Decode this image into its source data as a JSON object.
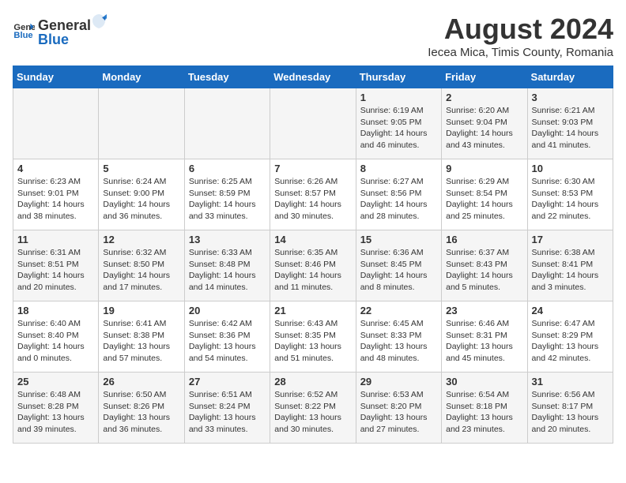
{
  "logo": {
    "general": "General",
    "blue": "Blue"
  },
  "title": "August 2024",
  "subtitle": "Iecea Mica, Timis County, Romania",
  "days_of_week": [
    "Sunday",
    "Monday",
    "Tuesday",
    "Wednesday",
    "Thursday",
    "Friday",
    "Saturday"
  ],
  "weeks": [
    [
      {
        "day": "",
        "content": ""
      },
      {
        "day": "",
        "content": ""
      },
      {
        "day": "",
        "content": ""
      },
      {
        "day": "",
        "content": ""
      },
      {
        "day": "1",
        "content": "Sunrise: 6:19 AM\nSunset: 9:05 PM\nDaylight: 14 hours and 46 minutes."
      },
      {
        "day": "2",
        "content": "Sunrise: 6:20 AM\nSunset: 9:04 PM\nDaylight: 14 hours and 43 minutes."
      },
      {
        "day": "3",
        "content": "Sunrise: 6:21 AM\nSunset: 9:03 PM\nDaylight: 14 hours and 41 minutes."
      }
    ],
    [
      {
        "day": "4",
        "content": "Sunrise: 6:23 AM\nSunset: 9:01 PM\nDaylight: 14 hours and 38 minutes."
      },
      {
        "day": "5",
        "content": "Sunrise: 6:24 AM\nSunset: 9:00 PM\nDaylight: 14 hours and 36 minutes."
      },
      {
        "day": "6",
        "content": "Sunrise: 6:25 AM\nSunset: 8:59 PM\nDaylight: 14 hours and 33 minutes."
      },
      {
        "day": "7",
        "content": "Sunrise: 6:26 AM\nSunset: 8:57 PM\nDaylight: 14 hours and 30 minutes."
      },
      {
        "day": "8",
        "content": "Sunrise: 6:27 AM\nSunset: 8:56 PM\nDaylight: 14 hours and 28 minutes."
      },
      {
        "day": "9",
        "content": "Sunrise: 6:29 AM\nSunset: 8:54 PM\nDaylight: 14 hours and 25 minutes."
      },
      {
        "day": "10",
        "content": "Sunrise: 6:30 AM\nSunset: 8:53 PM\nDaylight: 14 hours and 22 minutes."
      }
    ],
    [
      {
        "day": "11",
        "content": "Sunrise: 6:31 AM\nSunset: 8:51 PM\nDaylight: 14 hours and 20 minutes."
      },
      {
        "day": "12",
        "content": "Sunrise: 6:32 AM\nSunset: 8:50 PM\nDaylight: 14 hours and 17 minutes."
      },
      {
        "day": "13",
        "content": "Sunrise: 6:33 AM\nSunset: 8:48 PM\nDaylight: 14 hours and 14 minutes."
      },
      {
        "day": "14",
        "content": "Sunrise: 6:35 AM\nSunset: 8:46 PM\nDaylight: 14 hours and 11 minutes."
      },
      {
        "day": "15",
        "content": "Sunrise: 6:36 AM\nSunset: 8:45 PM\nDaylight: 14 hours and 8 minutes."
      },
      {
        "day": "16",
        "content": "Sunrise: 6:37 AM\nSunset: 8:43 PM\nDaylight: 14 hours and 5 minutes."
      },
      {
        "day": "17",
        "content": "Sunrise: 6:38 AM\nSunset: 8:41 PM\nDaylight: 14 hours and 3 minutes."
      }
    ],
    [
      {
        "day": "18",
        "content": "Sunrise: 6:40 AM\nSunset: 8:40 PM\nDaylight: 14 hours and 0 minutes."
      },
      {
        "day": "19",
        "content": "Sunrise: 6:41 AM\nSunset: 8:38 PM\nDaylight: 13 hours and 57 minutes."
      },
      {
        "day": "20",
        "content": "Sunrise: 6:42 AM\nSunset: 8:36 PM\nDaylight: 13 hours and 54 minutes."
      },
      {
        "day": "21",
        "content": "Sunrise: 6:43 AM\nSunset: 8:35 PM\nDaylight: 13 hours and 51 minutes."
      },
      {
        "day": "22",
        "content": "Sunrise: 6:45 AM\nSunset: 8:33 PM\nDaylight: 13 hours and 48 minutes."
      },
      {
        "day": "23",
        "content": "Sunrise: 6:46 AM\nSunset: 8:31 PM\nDaylight: 13 hours and 45 minutes."
      },
      {
        "day": "24",
        "content": "Sunrise: 6:47 AM\nSunset: 8:29 PM\nDaylight: 13 hours and 42 minutes."
      }
    ],
    [
      {
        "day": "25",
        "content": "Sunrise: 6:48 AM\nSunset: 8:28 PM\nDaylight: 13 hours and 39 minutes."
      },
      {
        "day": "26",
        "content": "Sunrise: 6:50 AM\nSunset: 8:26 PM\nDaylight: 13 hours and 36 minutes."
      },
      {
        "day": "27",
        "content": "Sunrise: 6:51 AM\nSunset: 8:24 PM\nDaylight: 13 hours and 33 minutes."
      },
      {
        "day": "28",
        "content": "Sunrise: 6:52 AM\nSunset: 8:22 PM\nDaylight: 13 hours and 30 minutes."
      },
      {
        "day": "29",
        "content": "Sunrise: 6:53 AM\nSunset: 8:20 PM\nDaylight: 13 hours and 27 minutes."
      },
      {
        "day": "30",
        "content": "Sunrise: 6:54 AM\nSunset: 8:18 PM\nDaylight: 13 hours and 23 minutes."
      },
      {
        "day": "31",
        "content": "Sunrise: 6:56 AM\nSunset: 8:17 PM\nDaylight: 13 hours and 20 minutes."
      }
    ]
  ]
}
